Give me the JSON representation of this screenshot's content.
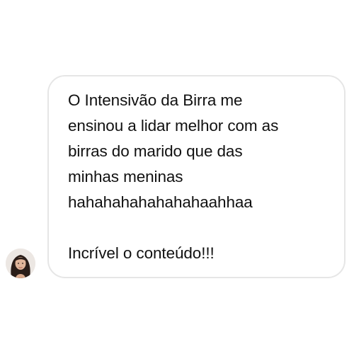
{
  "message": {
    "lines": [
      "O Intensivão da Birra me",
      "ensinou a lidar melhor com as",
      "birras do marido que das",
      "minhas meninas",
      "hahahahahahahahaahhaa"
    ],
    "closing": "Incrível o conteúdo!!!"
  },
  "sender": {
    "avatar_icon": "user-avatar-photo"
  },
  "colors": {
    "bubble_border": "#e6e6e6",
    "text": "#111111",
    "background": "#ffffff"
  }
}
